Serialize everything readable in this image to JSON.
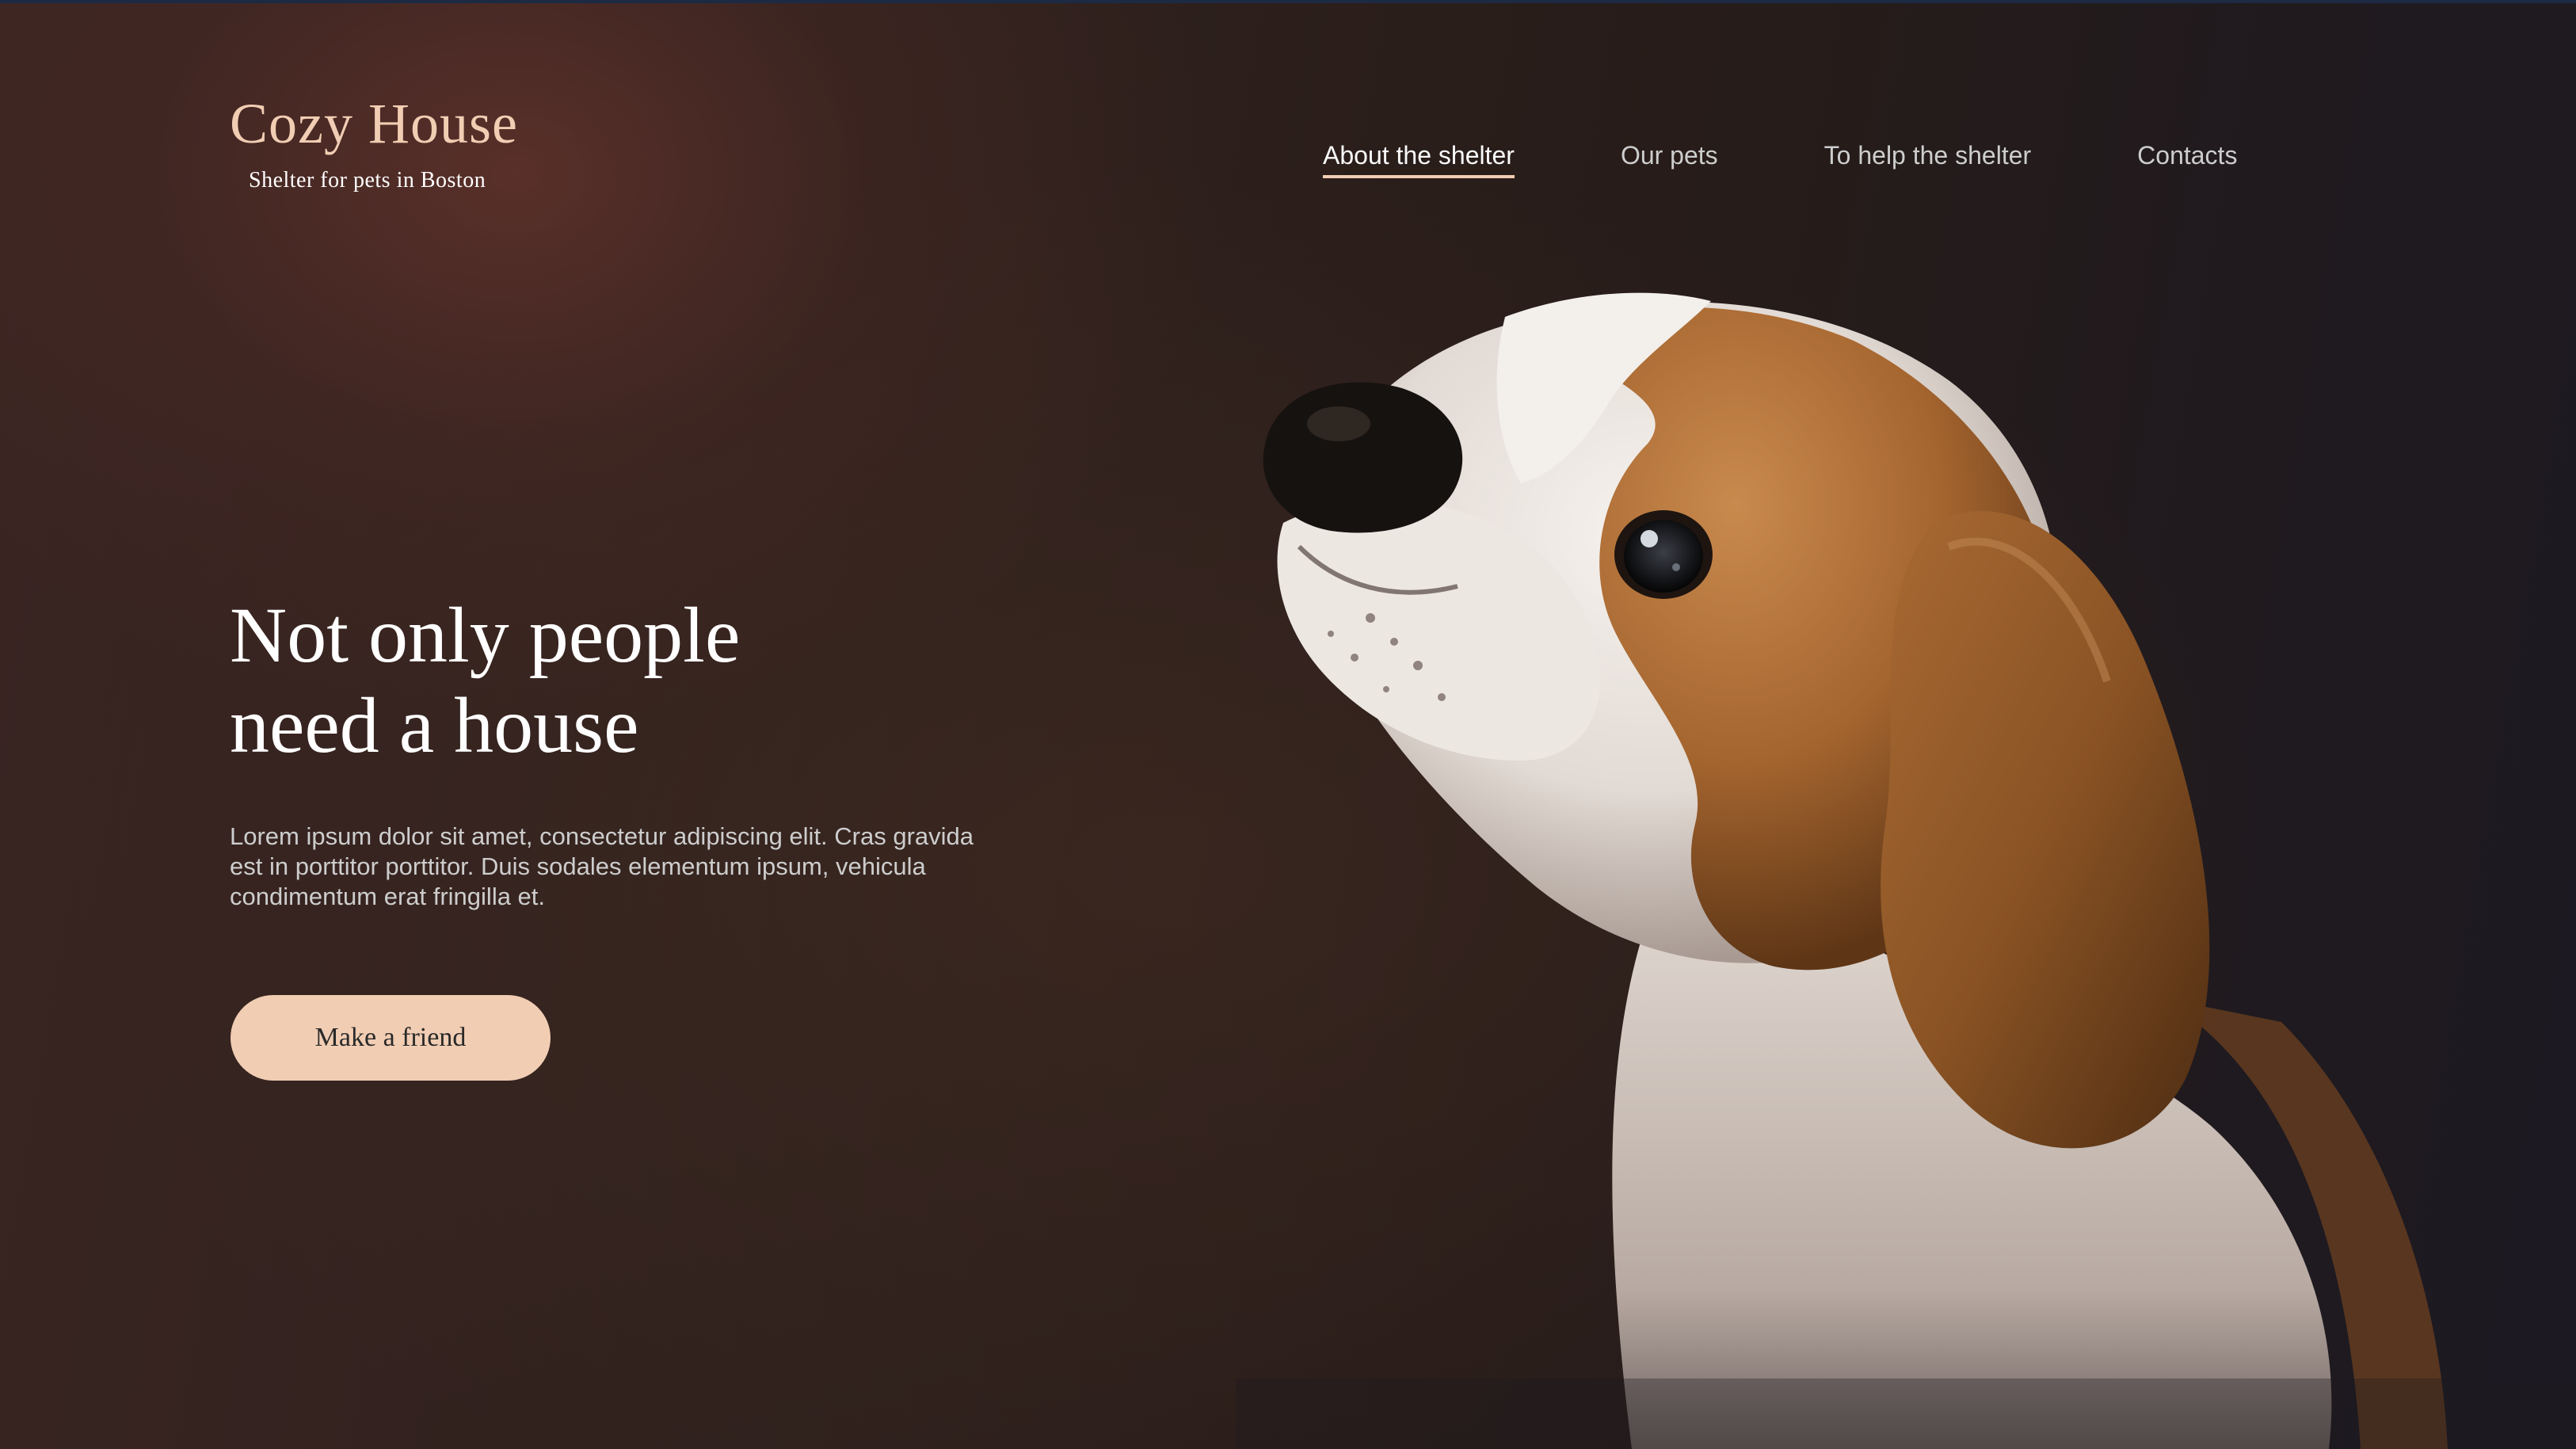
{
  "brand": {
    "title": "Cozy House",
    "subtitle": "Shelter for pets in Boston"
  },
  "nav": {
    "items": [
      {
        "label": "About the shelter",
        "active": true
      },
      {
        "label": "Our pets",
        "active": false
      },
      {
        "label": "To help the shelter",
        "active": false
      },
      {
        "label": "Contacts",
        "active": false
      }
    ]
  },
  "hero": {
    "title_line1": "Not only people",
    "title_line2": "need a house",
    "text": "Lorem ipsum dolor sit amet, consectetur adipiscing elit. Cras gravida est in porttitor porttitor. Duis sodales elementum ipsum, vehicula condimentum erat fringilla et.",
    "button_label": "Make a friend",
    "image": "beagle-puppy-photo"
  },
  "colors": {
    "accent": "#f1cdb3",
    "text_light": "#cdcdcd",
    "heading": "#ffffff",
    "button_text": "#292929",
    "background_dark": "#2a1f1c"
  }
}
